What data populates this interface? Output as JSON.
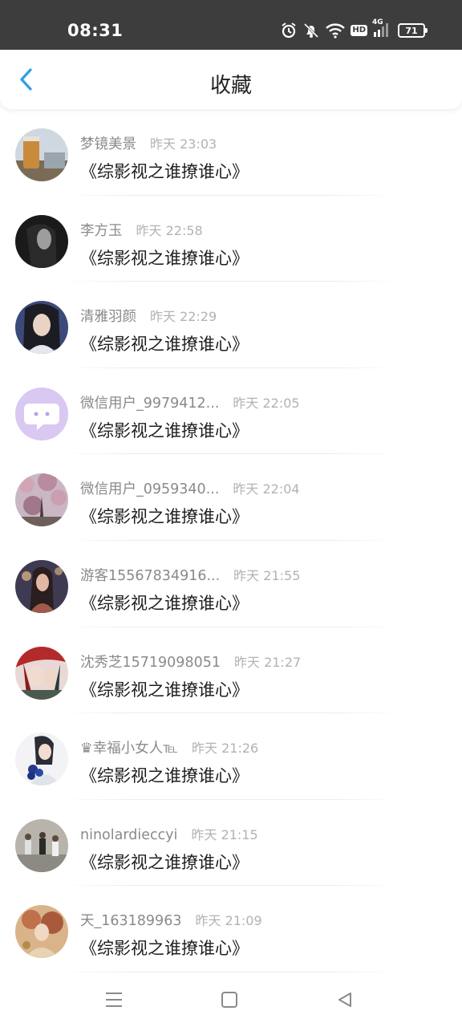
{
  "status_bar": {
    "time": "08:31",
    "icons": [
      "alarm-icon",
      "bell-off-icon",
      "wifi-icon",
      "hd-icon",
      "signal-4g-icon",
      "battery-icon"
    ],
    "hd_label": "HD",
    "network_label": "4G",
    "battery_level": "71"
  },
  "header": {
    "back_icon": "chevron-left-icon",
    "title": "收藏"
  },
  "colors": {
    "status_bar_bg": "#3d3d3d",
    "accent": "#2f9ee8",
    "username": "#8a8a8a",
    "time": "#b2b2b2",
    "title_text": "#1e1e1e"
  },
  "favorites": [
    {
      "username": "梦镜美景",
      "time": "昨天 23:03",
      "title": "《综影视之谁撩谁心》"
    },
    {
      "username": "李方玉",
      "time": "昨天 22:58",
      "title": "《综影视之谁撩谁心》"
    },
    {
      "username": "清雅羽颜",
      "time": "昨天 22:29",
      "title": "《综影视之谁撩谁心》"
    },
    {
      "username": "微信用户_9979412...",
      "time": "昨天 22:05",
      "title": "《综影视之谁撩谁心》"
    },
    {
      "username": "微信用户_0959340...",
      "time": "昨天 22:04",
      "title": "《综影视之谁撩谁心》"
    },
    {
      "username": "游客15567834916...",
      "time": "昨天 21:55",
      "title": "《综影视之谁撩谁心》"
    },
    {
      "username": "沈秀芝15719098051",
      "time": "昨天 21:27",
      "title": "《综影视之谁撩谁心》"
    },
    {
      "username": "♛幸福小女人℡",
      "time": "昨天 21:26",
      "title": "《综影视之谁撩谁心》"
    },
    {
      "username": "ninolardieccyi",
      "time": "昨天 21:15",
      "title": "《综影视之谁撩谁心》"
    },
    {
      "username": "天_163189963",
      "time": "昨天 21:09",
      "title": "《综影视之谁撩谁心》"
    }
  ],
  "nav_bar": {
    "items": [
      "menu-icon",
      "home-square-icon",
      "back-triangle-icon"
    ]
  }
}
